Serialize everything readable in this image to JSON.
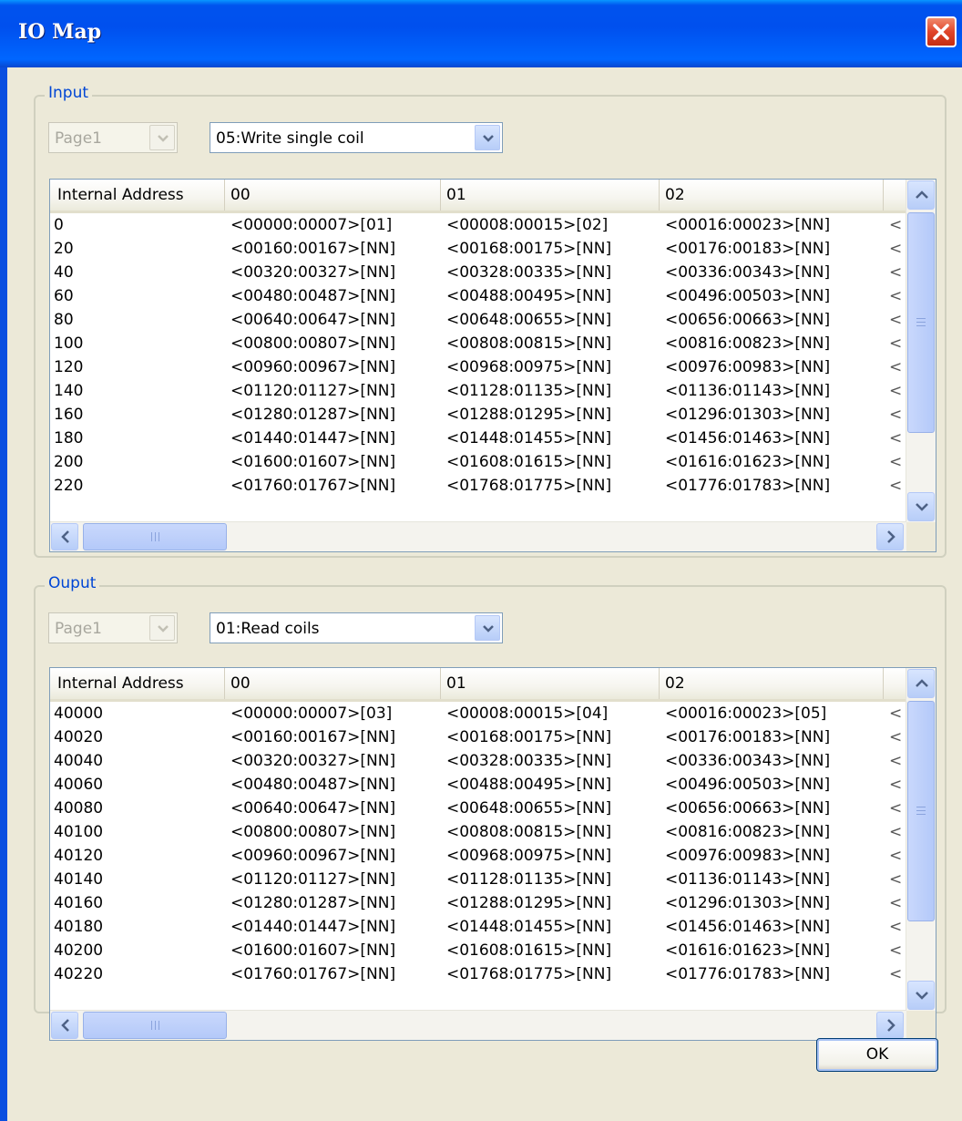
{
  "window": {
    "title": "IO Map"
  },
  "input": {
    "label": "Input",
    "page_value": "Page1",
    "function_value": "05:Write single coil",
    "columns": [
      "Internal Address",
      "00",
      "01",
      "02",
      ""
    ],
    "rows": [
      [
        "0",
        "<00000:00007>[01]",
        "<00008:00015>[02]",
        "<00016:00023>[NN]",
        "<"
      ],
      [
        "20",
        "<00160:00167>[NN]",
        "<00168:00175>[NN]",
        "<00176:00183>[NN]",
        "<"
      ],
      [
        "40",
        "<00320:00327>[NN]",
        "<00328:00335>[NN]",
        "<00336:00343>[NN]",
        "<"
      ],
      [
        "60",
        "<00480:00487>[NN]",
        "<00488:00495>[NN]",
        "<00496:00503>[NN]",
        "<"
      ],
      [
        "80",
        "<00640:00647>[NN]",
        "<00648:00655>[NN]",
        "<00656:00663>[NN]",
        "<"
      ],
      [
        "100",
        "<00800:00807>[NN]",
        "<00808:00815>[NN]",
        "<00816:00823>[NN]",
        "<"
      ],
      [
        "120",
        "<00960:00967>[NN]",
        "<00968:00975>[NN]",
        "<00976:00983>[NN]",
        "<"
      ],
      [
        "140",
        "<01120:01127>[NN]",
        "<01128:01135>[NN]",
        "<01136:01143>[NN]",
        "<"
      ],
      [
        "160",
        "<01280:01287>[NN]",
        "<01288:01295>[NN]",
        "<01296:01303>[NN]",
        "<"
      ],
      [
        "180",
        "<01440:01447>[NN]",
        "<01448:01455>[NN]",
        "<01456:01463>[NN]",
        "<"
      ],
      [
        "200",
        "<01600:01607>[NN]",
        "<01608:01615>[NN]",
        "<01616:01623>[NN]",
        "<"
      ],
      [
        "220",
        "<01760:01767>[NN]",
        "<01768:01775>[NN]",
        "<01776:01783>[NN]",
        "<"
      ]
    ]
  },
  "output": {
    "label": "Ouput",
    "page_value": "Page1",
    "function_value": "01:Read coils",
    "columns": [
      "Internal Address",
      "00",
      "01",
      "02",
      ""
    ],
    "rows": [
      [
        "40000",
        "<00000:00007>[03]",
        "<00008:00015>[04]",
        "<00016:00023>[05]",
        "<"
      ],
      [
        "40020",
        "<00160:00167>[NN]",
        "<00168:00175>[NN]",
        "<00176:00183>[NN]",
        "<"
      ],
      [
        "40040",
        "<00320:00327>[NN]",
        "<00328:00335>[NN]",
        "<00336:00343>[NN]",
        "<"
      ],
      [
        "40060",
        "<00480:00487>[NN]",
        "<00488:00495>[NN]",
        "<00496:00503>[NN]",
        "<"
      ],
      [
        "40080",
        "<00640:00647>[NN]",
        "<00648:00655>[NN]",
        "<00656:00663>[NN]",
        "<"
      ],
      [
        "40100",
        "<00800:00807>[NN]",
        "<00808:00815>[NN]",
        "<00816:00823>[NN]",
        "<"
      ],
      [
        "40120",
        "<00960:00967>[NN]",
        "<00968:00975>[NN]",
        "<00976:00983>[NN]",
        "<"
      ],
      [
        "40140",
        "<01120:01127>[NN]",
        "<01128:01135>[NN]",
        "<01136:01143>[NN]",
        "<"
      ],
      [
        "40160",
        "<01280:01287>[NN]",
        "<01288:01295>[NN]",
        "<01296:01303>[NN]",
        "<"
      ],
      [
        "40180",
        "<01440:01447>[NN]",
        "<01448:01455>[NN]",
        "<01456:01463>[NN]",
        "<"
      ],
      [
        "40200",
        "<01600:01607>[NN]",
        "<01608:01615>[NN]",
        "<01616:01623>[NN]",
        "<"
      ],
      [
        "40220",
        "<01760:01767>[NN]",
        "<01768:01775>[NN]",
        "<01776:01783>[NN]",
        "<"
      ]
    ]
  },
  "ok_label": "OK",
  "icons": {
    "close": "close-icon",
    "dropdown": "chevron-down-icon",
    "scroll_up": "arrow-up-icon",
    "scroll_down": "arrow-down-icon",
    "scroll_left": "arrow-left-icon",
    "scroll_right": "arrow-right-icon"
  },
  "colors": {
    "titlebar": "#0053ee",
    "group_label": "#0046d5",
    "dialog_bg": "#ece9d8"
  }
}
